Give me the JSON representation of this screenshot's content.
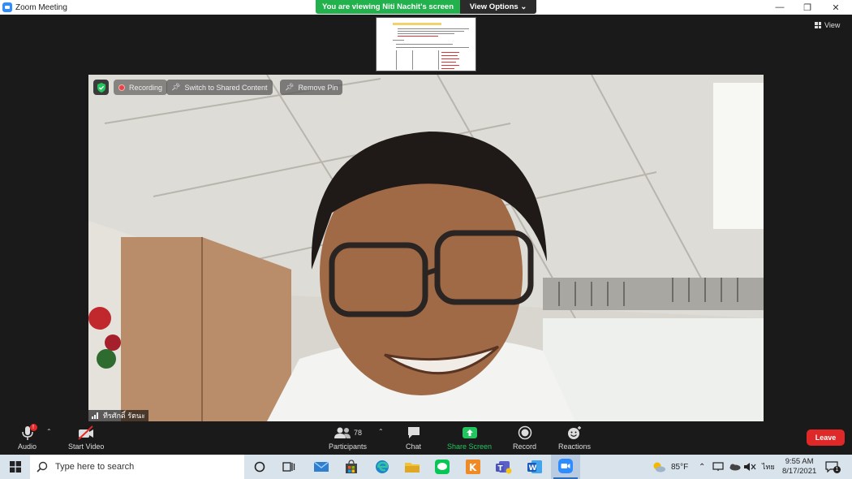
{
  "window": {
    "title": "Zoom Meeting",
    "minimize": "—",
    "restore": "❐",
    "close": "✕"
  },
  "share_banner": {
    "text": "You are viewing Niti Nachit's screen",
    "view_options": "View Options ⌄"
  },
  "view_button": {
    "label": "View"
  },
  "video_overlay": {
    "recording": "Recording",
    "switch_to_shared": "Switch to Shared Content",
    "remove_pin": "Remove Pin",
    "participant_name": "ทีรศักดิ์  รัตนะ"
  },
  "controls": {
    "audio": "Audio",
    "audio_badge": "!",
    "start_video": "Start Video",
    "participants": "Participants",
    "participant_count": "78",
    "chat": "Chat",
    "share_screen": "Share Screen",
    "record": "Record",
    "reactions": "Reactions",
    "leave": "Leave"
  },
  "taskbar": {
    "search_placeholder": "Type here to search",
    "temperature": "85°F",
    "language": "ไทย",
    "time": "9:55 AM",
    "date": "8/17/2021",
    "notification_count": "1"
  },
  "colors": {
    "share_green": "#23b14d",
    "zoom_blue": "#2d8cff",
    "leave_red": "#e02828"
  }
}
